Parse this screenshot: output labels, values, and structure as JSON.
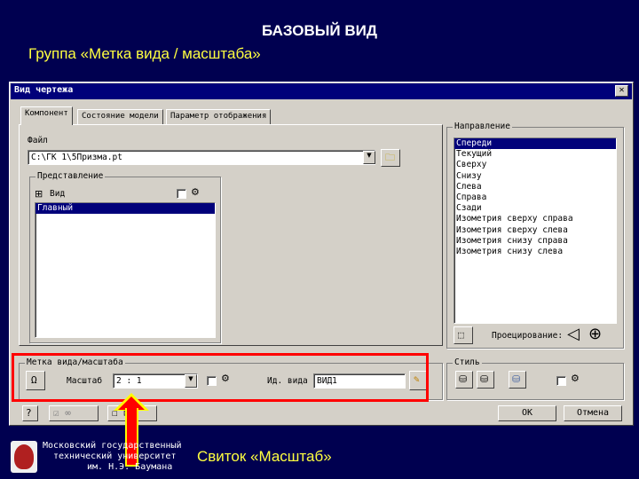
{
  "slide": {
    "title": "БАЗОВЫЙ ВИД",
    "subtitle": "Группа «Метка вида / масштаба»",
    "caption": "Свиток «Масштаб»",
    "university": [
      "Московский государственный",
      "технический университет",
      "им. Н.Э. Баумана"
    ]
  },
  "dialog": {
    "title": "Вид чертежа",
    "close": "✕",
    "tabs": [
      "Компонент",
      "Состояние модели",
      "Параметр отображения"
    ],
    "file": {
      "label": "Файл",
      "value": "C:\\ГК 1\\5Призма.pt"
    },
    "representation": {
      "title": "Представление",
      "view_label": "Вид",
      "items": [
        "Главный"
      ]
    },
    "direction": {
      "title": "Направление",
      "items": [
        "Спереди",
        "Текущий",
        "Сверху",
        "Снизу",
        "Слева",
        "Справа",
        "Сзади",
        "Изометрия сверху справа",
        "Изометрия сверху слева",
        "Изометрия снизу справа",
        "Изометрия снизу слева"
      ],
      "selected_index": 0,
      "projection_label": "Проецирование:"
    },
    "scale": {
      "title": "Метка вида/масштаба",
      "scale_label": "Масштаб",
      "scale_value": "2 : 1",
      "view_id_label": "Ид. вида",
      "view_id_value": "ВИД1"
    },
    "style": {
      "title": "Стиль"
    },
    "buttons": {
      "ok": "ОК",
      "cancel": "Отмена"
    }
  },
  "colors": {
    "background": "#000050",
    "highlight": "#ff0000",
    "caption": "#ffff40"
  }
}
